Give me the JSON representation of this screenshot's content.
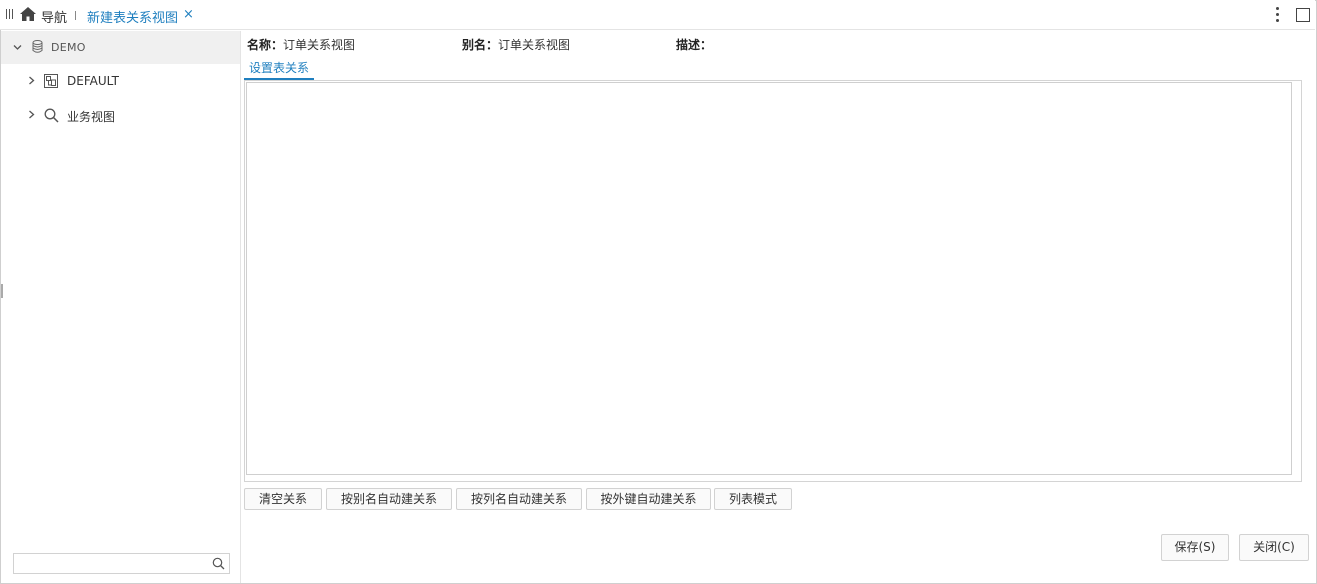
{
  "tabbar": {
    "nav_label": "导航",
    "active_tab": "新建表关系视图",
    "close_glyph": "×"
  },
  "sidebar": {
    "root": {
      "label": "DEMO",
      "icon": "database-icon"
    },
    "items": [
      {
        "label": "DEFAULT",
        "icon": "schema-icon"
      },
      {
        "label": "业务视图",
        "icon": "search-icon"
      }
    ],
    "search_placeholder": ""
  },
  "fields": {
    "name_label": "名称：",
    "name_value": "订单关系视图",
    "alias_label": "别名：",
    "alias_value": "订单关系视图",
    "desc_label": "描述：",
    "desc_value": ""
  },
  "subtab": "设置表关系",
  "toolbar": {
    "clear": "清空关系",
    "by_alias": "按别名自动建关系",
    "by_column": "按列名自动建关系",
    "by_fk": "按外键自动建关系",
    "list_mode": "列表模式"
  },
  "footer": {
    "save": "保存(S)",
    "close": "关闭(C)"
  },
  "colors": {
    "accent": "#1f7fbf",
    "border": "#d2d2d2",
    "tree_selected_bg": "#f0f0f0"
  }
}
